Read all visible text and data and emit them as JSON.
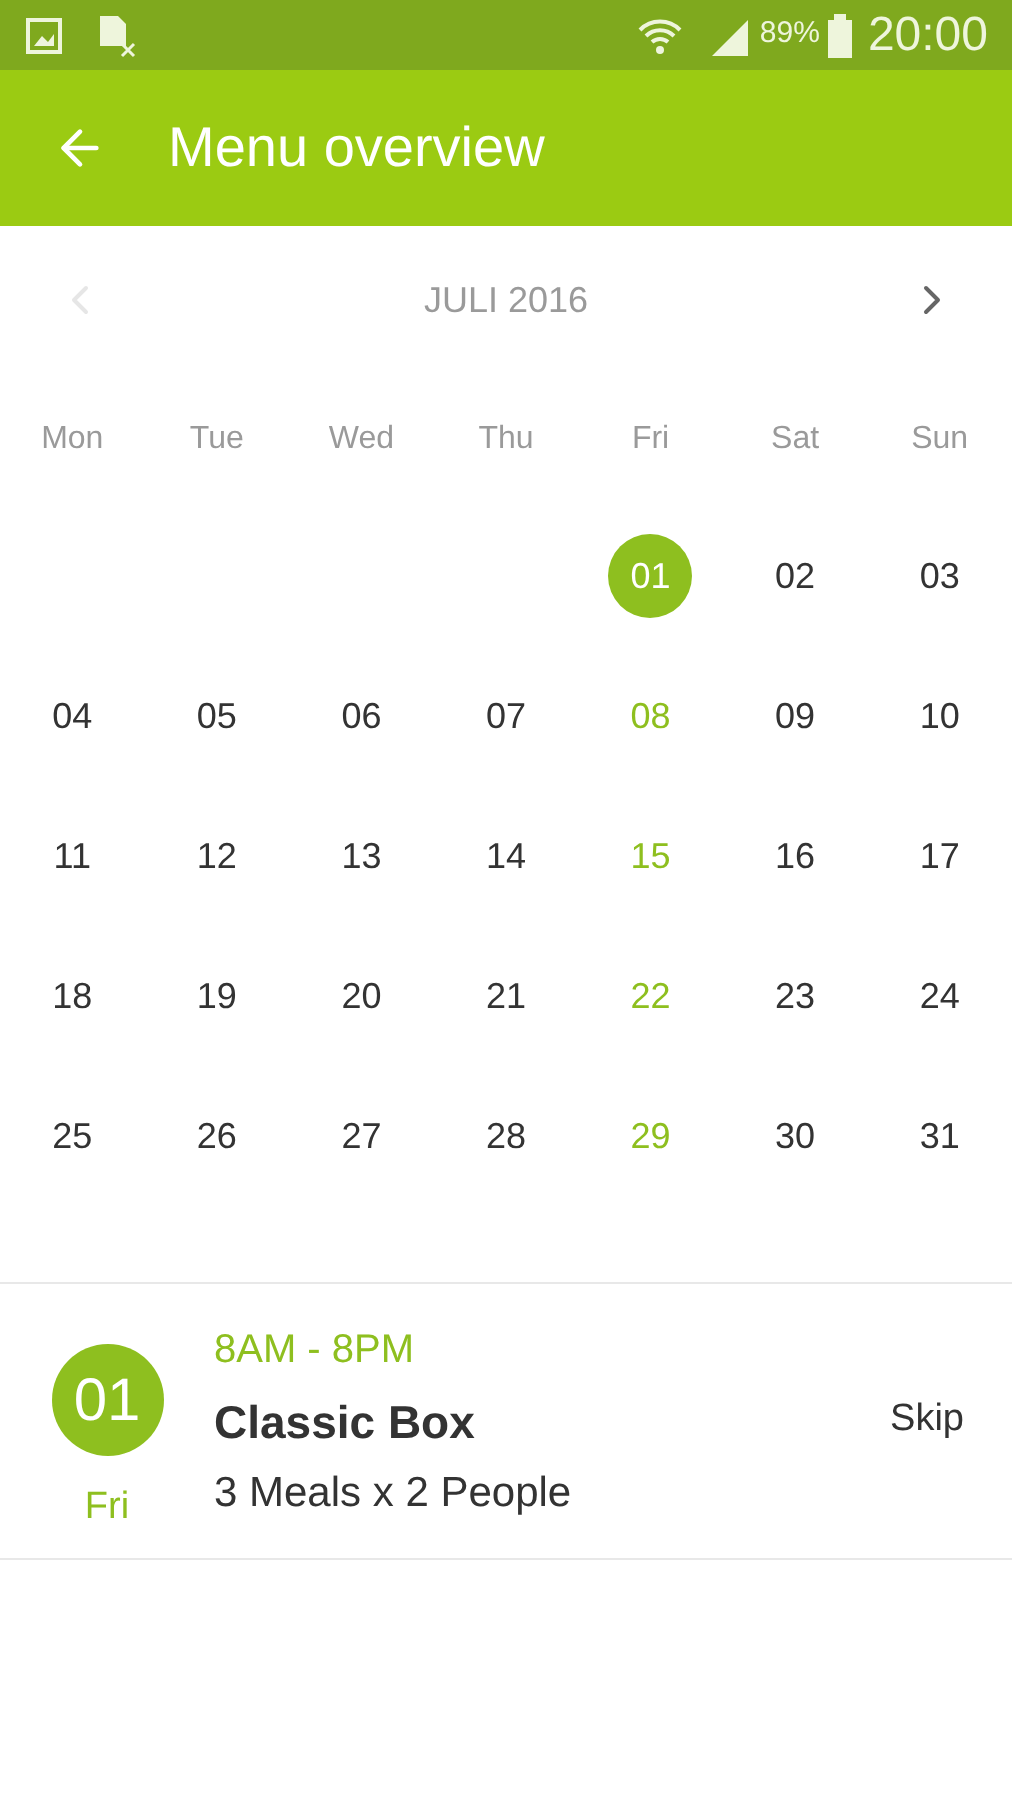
{
  "status_bar": {
    "battery": "89%",
    "time": "20:00"
  },
  "toolbar": {
    "title": "Menu overview"
  },
  "calendar": {
    "month": "JULI 2016",
    "prev": {
      "disabled": true
    },
    "next": {
      "disabled": false
    },
    "weekdays": [
      "Mon",
      "Tue",
      "Wed",
      "Thu",
      "Fri",
      "Sat",
      "Sun"
    ],
    "weeks": [
      [
        {
          "kind": "blank"
        },
        {
          "kind": "blank"
        },
        {
          "kind": "blank"
        },
        {
          "kind": "blank"
        },
        {
          "kind": "day",
          "label": "01",
          "selected": true,
          "delivery": true
        },
        {
          "kind": "day",
          "label": "02",
          "selected": false,
          "delivery": false
        },
        {
          "kind": "day",
          "label": "03",
          "selected": false,
          "delivery": false
        }
      ],
      [
        {
          "kind": "day",
          "label": "04",
          "selected": false,
          "delivery": false
        },
        {
          "kind": "day",
          "label": "05",
          "selected": false,
          "delivery": false
        },
        {
          "kind": "day",
          "label": "06",
          "selected": false,
          "delivery": false
        },
        {
          "kind": "day",
          "label": "07",
          "selected": false,
          "delivery": false
        },
        {
          "kind": "day",
          "label": "08",
          "selected": false,
          "delivery": true
        },
        {
          "kind": "day",
          "label": "09",
          "selected": false,
          "delivery": false
        },
        {
          "kind": "day",
          "label": "10",
          "selected": false,
          "delivery": false
        }
      ],
      [
        {
          "kind": "day",
          "label": "11",
          "selected": false,
          "delivery": false
        },
        {
          "kind": "day",
          "label": "12",
          "selected": false,
          "delivery": false
        },
        {
          "kind": "day",
          "label": "13",
          "selected": false,
          "delivery": false
        },
        {
          "kind": "day",
          "label": "14",
          "selected": false,
          "delivery": false
        },
        {
          "kind": "day",
          "label": "15",
          "selected": false,
          "delivery": true
        },
        {
          "kind": "day",
          "label": "16",
          "selected": false,
          "delivery": false
        },
        {
          "kind": "day",
          "label": "17",
          "selected": false,
          "delivery": false
        }
      ],
      [
        {
          "kind": "day",
          "label": "18",
          "selected": false,
          "delivery": false
        },
        {
          "kind": "day",
          "label": "19",
          "selected": false,
          "delivery": false
        },
        {
          "kind": "day",
          "label": "20",
          "selected": false,
          "delivery": false
        },
        {
          "kind": "day",
          "label": "21",
          "selected": false,
          "delivery": false
        },
        {
          "kind": "day",
          "label": "22",
          "selected": false,
          "delivery": true
        },
        {
          "kind": "day",
          "label": "23",
          "selected": false,
          "delivery": false
        },
        {
          "kind": "day",
          "label": "24",
          "selected": false,
          "delivery": false
        }
      ],
      [
        {
          "kind": "day",
          "label": "25",
          "selected": false,
          "delivery": false
        },
        {
          "kind": "day",
          "label": "26",
          "selected": false,
          "delivery": false
        },
        {
          "kind": "day",
          "label": "27",
          "selected": false,
          "delivery": false
        },
        {
          "kind": "day",
          "label": "28",
          "selected": false,
          "delivery": false
        },
        {
          "kind": "day",
          "label": "29",
          "selected": false,
          "delivery": true
        },
        {
          "kind": "day",
          "label": "30",
          "selected": false,
          "delivery": false
        },
        {
          "kind": "day",
          "label": "31",
          "selected": false,
          "delivery": false
        }
      ]
    ]
  },
  "delivery": {
    "date": "01",
    "weekday": "Fri",
    "time": "8AM - 8PM",
    "title": "Classic Box",
    "details": "3 Meals x 2 People",
    "action": "Skip"
  }
}
